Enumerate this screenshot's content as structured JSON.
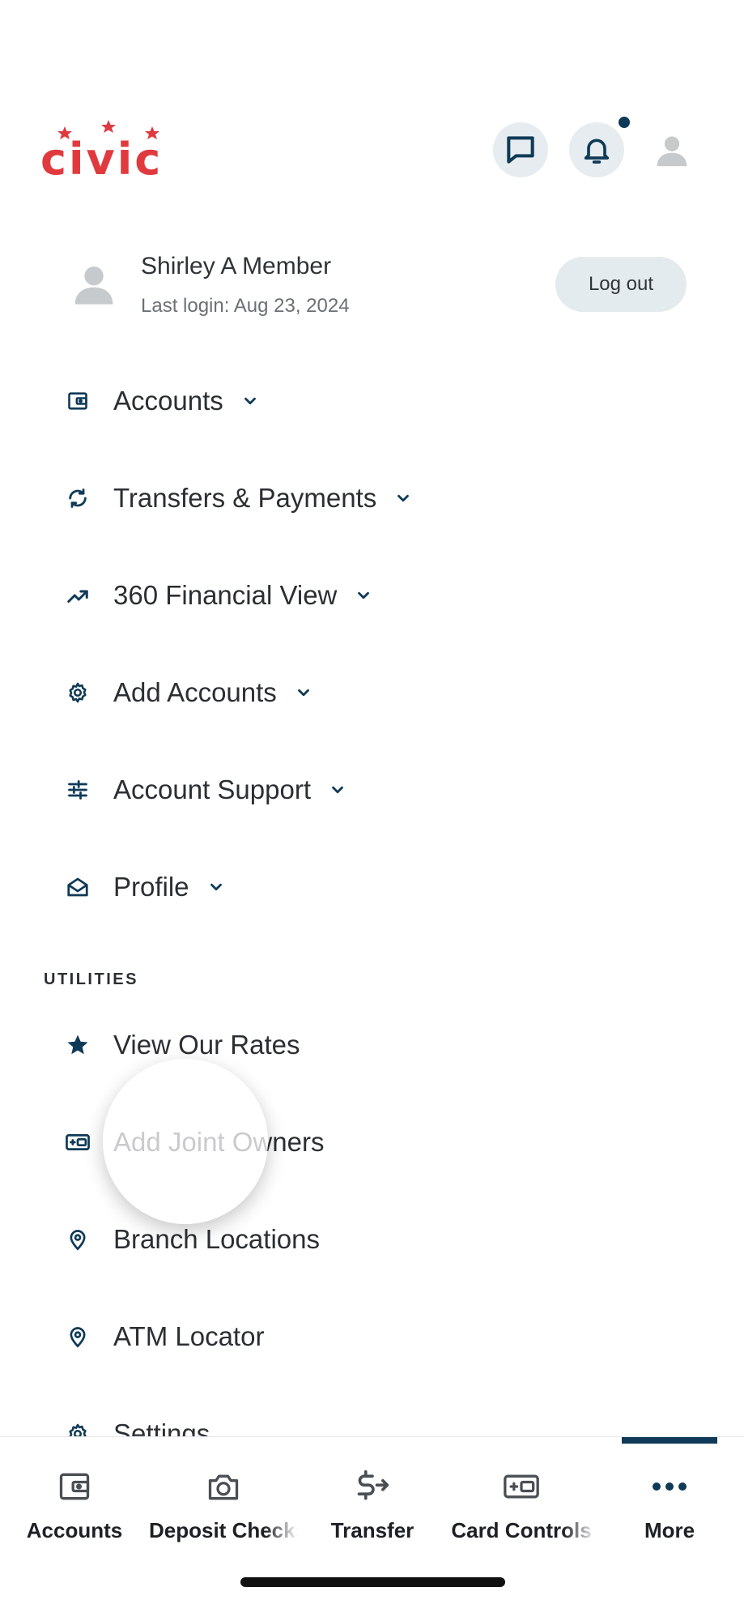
{
  "brand": {
    "logo_text": "civic",
    "color": "#e03a3e"
  },
  "header": {
    "chat_icon": "chat-icon",
    "bell_icon": "bell-icon",
    "avatar_icon": "user-avatar-icon",
    "has_notification": true
  },
  "user": {
    "name": "Shirley A Member",
    "last_login": "Last login: Aug 23, 2024",
    "logout_label": "Log out"
  },
  "menu": [
    {
      "label": "Accounts",
      "icon": "wallet-icon",
      "expandable": true
    },
    {
      "label": "Transfers & Payments",
      "icon": "refresh-icon",
      "expandable": true
    },
    {
      "label": "360 Financial View",
      "icon": "trending-up-icon",
      "expandable": true
    },
    {
      "label": "Add Accounts",
      "icon": "gear-icon",
      "expandable": true
    },
    {
      "label": "Account Support",
      "icon": "sliders-icon",
      "expandable": true
    },
    {
      "label": "Profile",
      "icon": "envelope-open-icon",
      "expandable": true
    }
  ],
  "utilities": {
    "heading": "UTILITIES",
    "items": [
      {
        "label": "View Our Rates",
        "icon": "star-icon"
      },
      {
        "label": "Add Joint Owners",
        "icon": "card-add-icon"
      },
      {
        "label": "Branch Locations",
        "icon": "location-pin-icon"
      },
      {
        "label": "ATM Locator",
        "icon": "location-pin-icon"
      },
      {
        "label": "Settings",
        "icon": "gear-icon"
      }
    ]
  },
  "bottom_nav": {
    "active": "More",
    "items": [
      {
        "label": "Accounts",
        "icon": "wallet-icon"
      },
      {
        "label": "Deposit Checks",
        "icon": "camera-icon"
      },
      {
        "label": "Transfer",
        "icon": "dollar-transfer-icon"
      },
      {
        "label": "Card Controls",
        "icon": "card-controls-icon"
      },
      {
        "label": "More",
        "icon": "more-dots-icon"
      }
    ]
  },
  "colors": {
    "accent": "#0f3a57",
    "icon_bg": "#e6ecef",
    "text": "#2b2f33"
  }
}
